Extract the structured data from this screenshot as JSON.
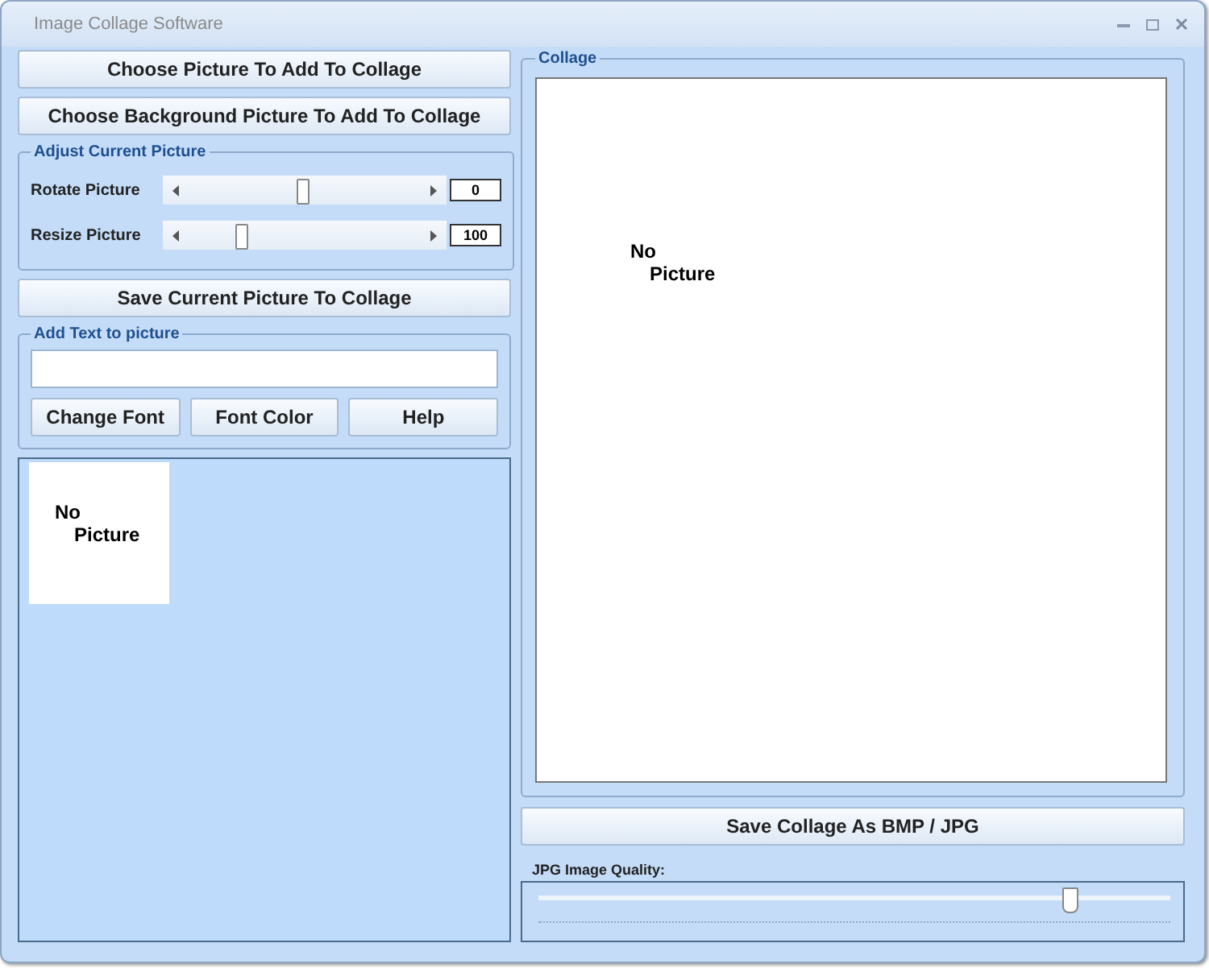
{
  "window": {
    "title": "Image Collage Software"
  },
  "buttons_top": [
    "Choose Picture To Add To Collage",
    "Choose Background Picture To Add To Collage"
  ],
  "adjust": {
    "title": "Adjust Current Picture",
    "sliders": [
      {
        "label": "Rotate Picture",
        "level": 0.49,
        "value": "0"
      },
      {
        "label": "Resize Picture",
        "level": 0.27,
        "value": "100"
      }
    ]
  },
  "save_picture_button": "Save Current Picture To Collage",
  "add_text": {
    "title": "Add Text to picture",
    "buttons": [
      "Change Font",
      "Font Color",
      "Help"
    ]
  },
  "thumbnail": {
    "lines": [
      "No",
      "Picture"
    ]
  },
  "collage": {
    "title": "Collage",
    "lines": [
      "No",
      "Picture"
    ]
  },
  "save_collage_button": "Save Collage As BMP / JPG",
  "quality": {
    "label": "JPG Image Quality:",
    "level": 0.84
  }
}
